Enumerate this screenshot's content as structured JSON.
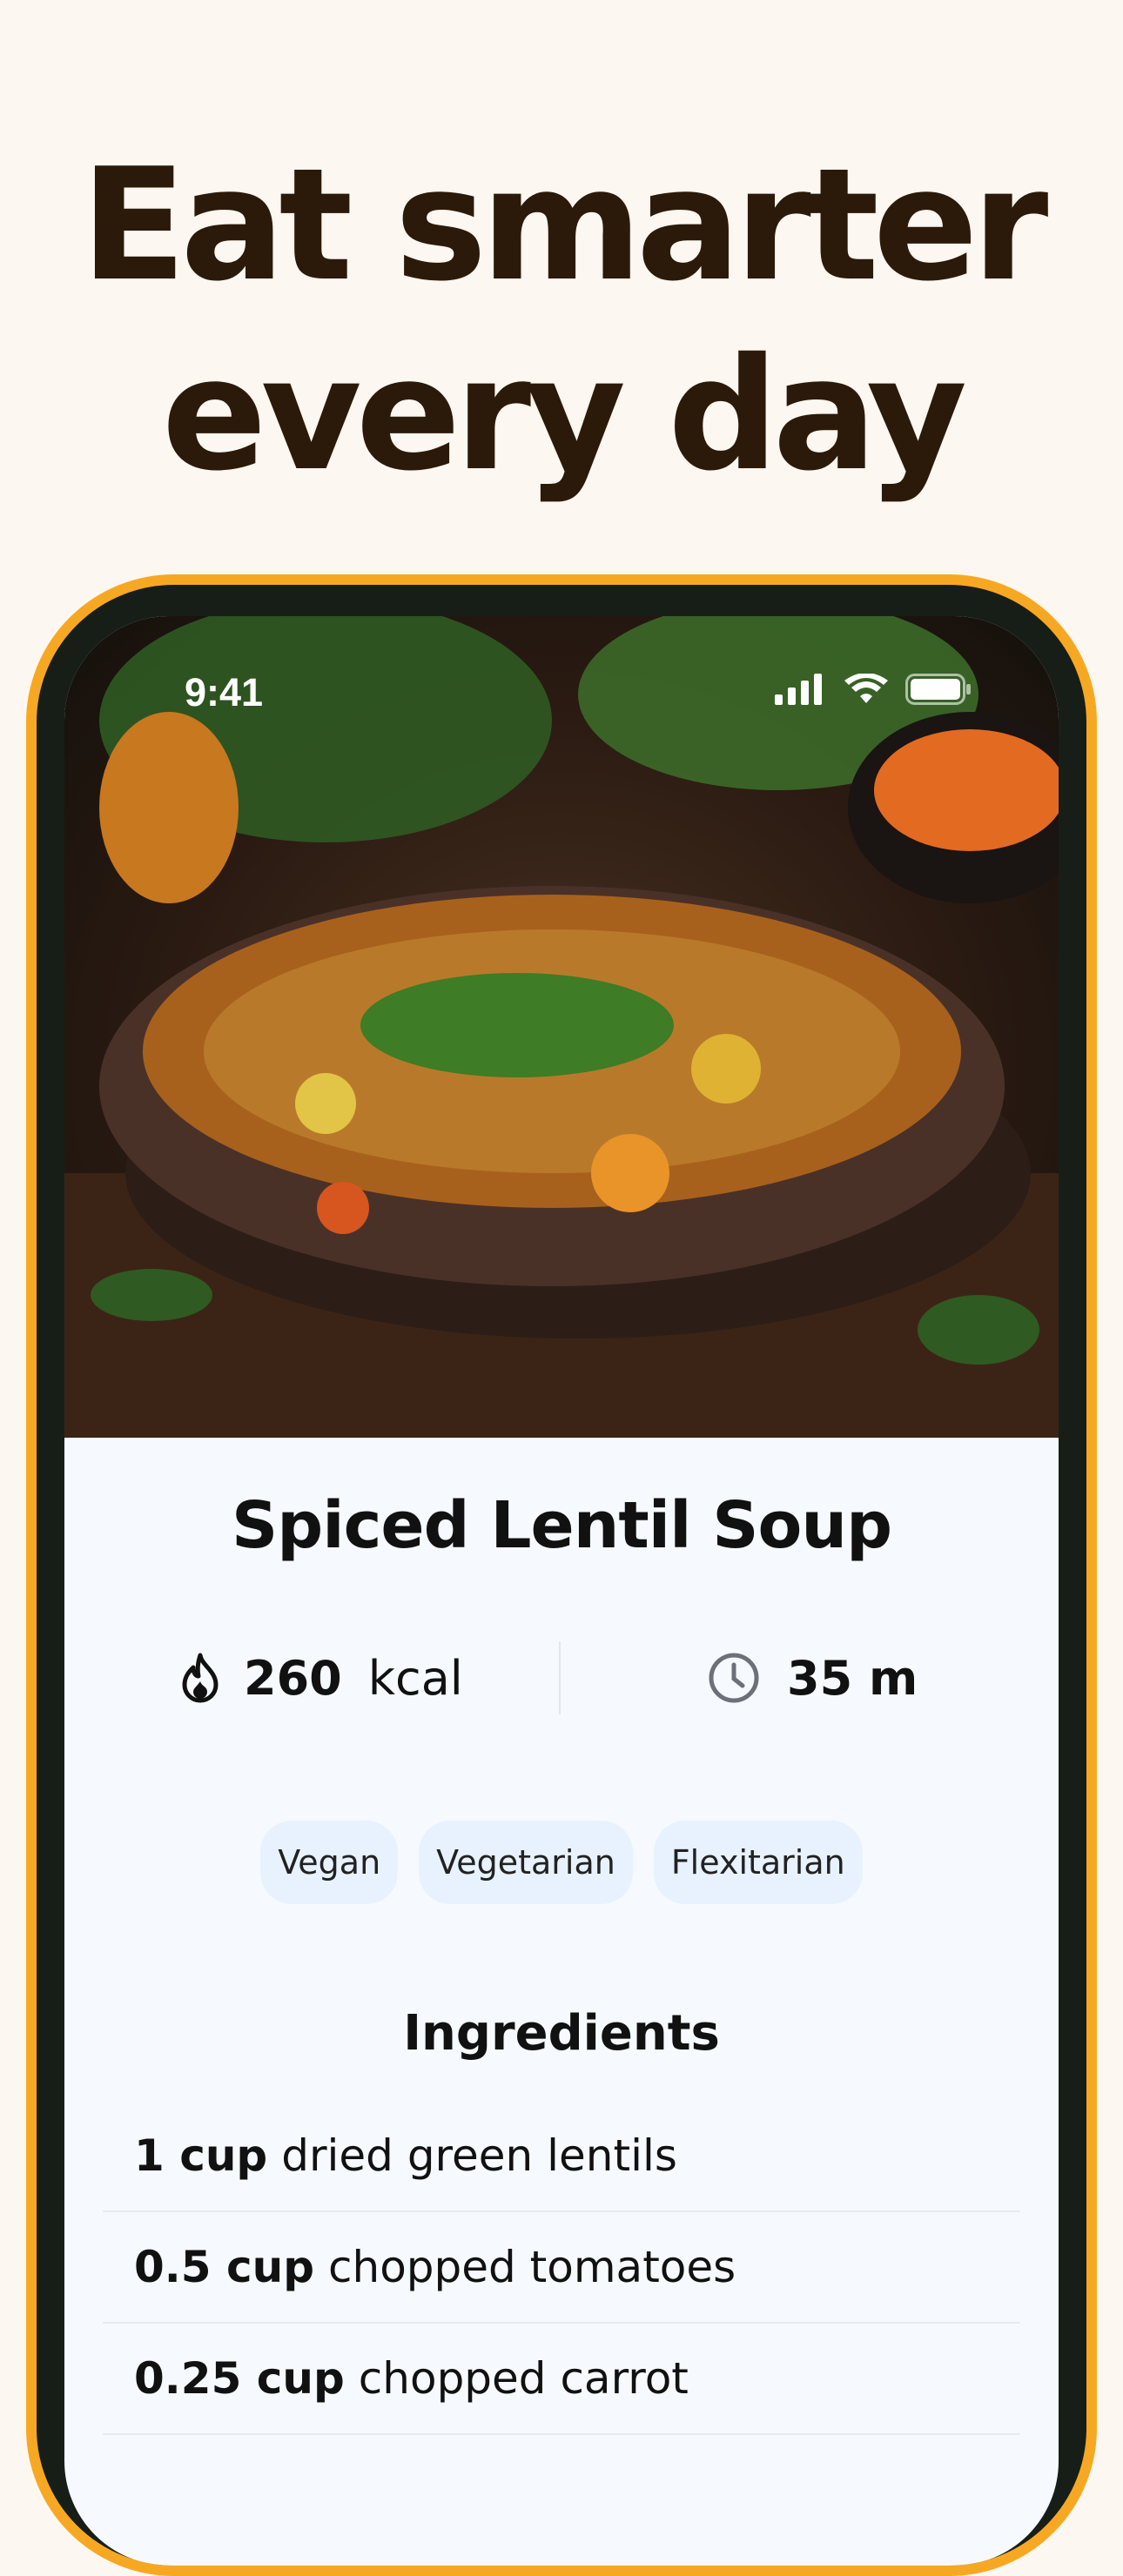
{
  "headline": {
    "line1": "Eat smarter",
    "line2": "every day"
  },
  "status_bar": {
    "time": "9:41"
  },
  "recipe": {
    "title": "Spiced Lentil Soup",
    "calories": {
      "value": "260",
      "unit": "kcal",
      "icon": "flame-icon"
    },
    "duration": {
      "value": "35 m",
      "icon": "clock-icon"
    },
    "tags": [
      "Vegan",
      "Vegetarian",
      "Flexitarian"
    ],
    "ingredients_title": "Ingredients",
    "ingredients": [
      {
        "qty": "1 cup",
        "name": "dried green lentils"
      },
      {
        "qty": "0.5 cup",
        "name": "chopped tomatoes"
      },
      {
        "qty": "0.25 cup",
        "name": "chopped carrot"
      }
    ]
  },
  "colors": {
    "frame": "#f7a823",
    "background": "#fdf7f1",
    "headline": "#2b1a09",
    "chip": "#e8f2ff"
  }
}
